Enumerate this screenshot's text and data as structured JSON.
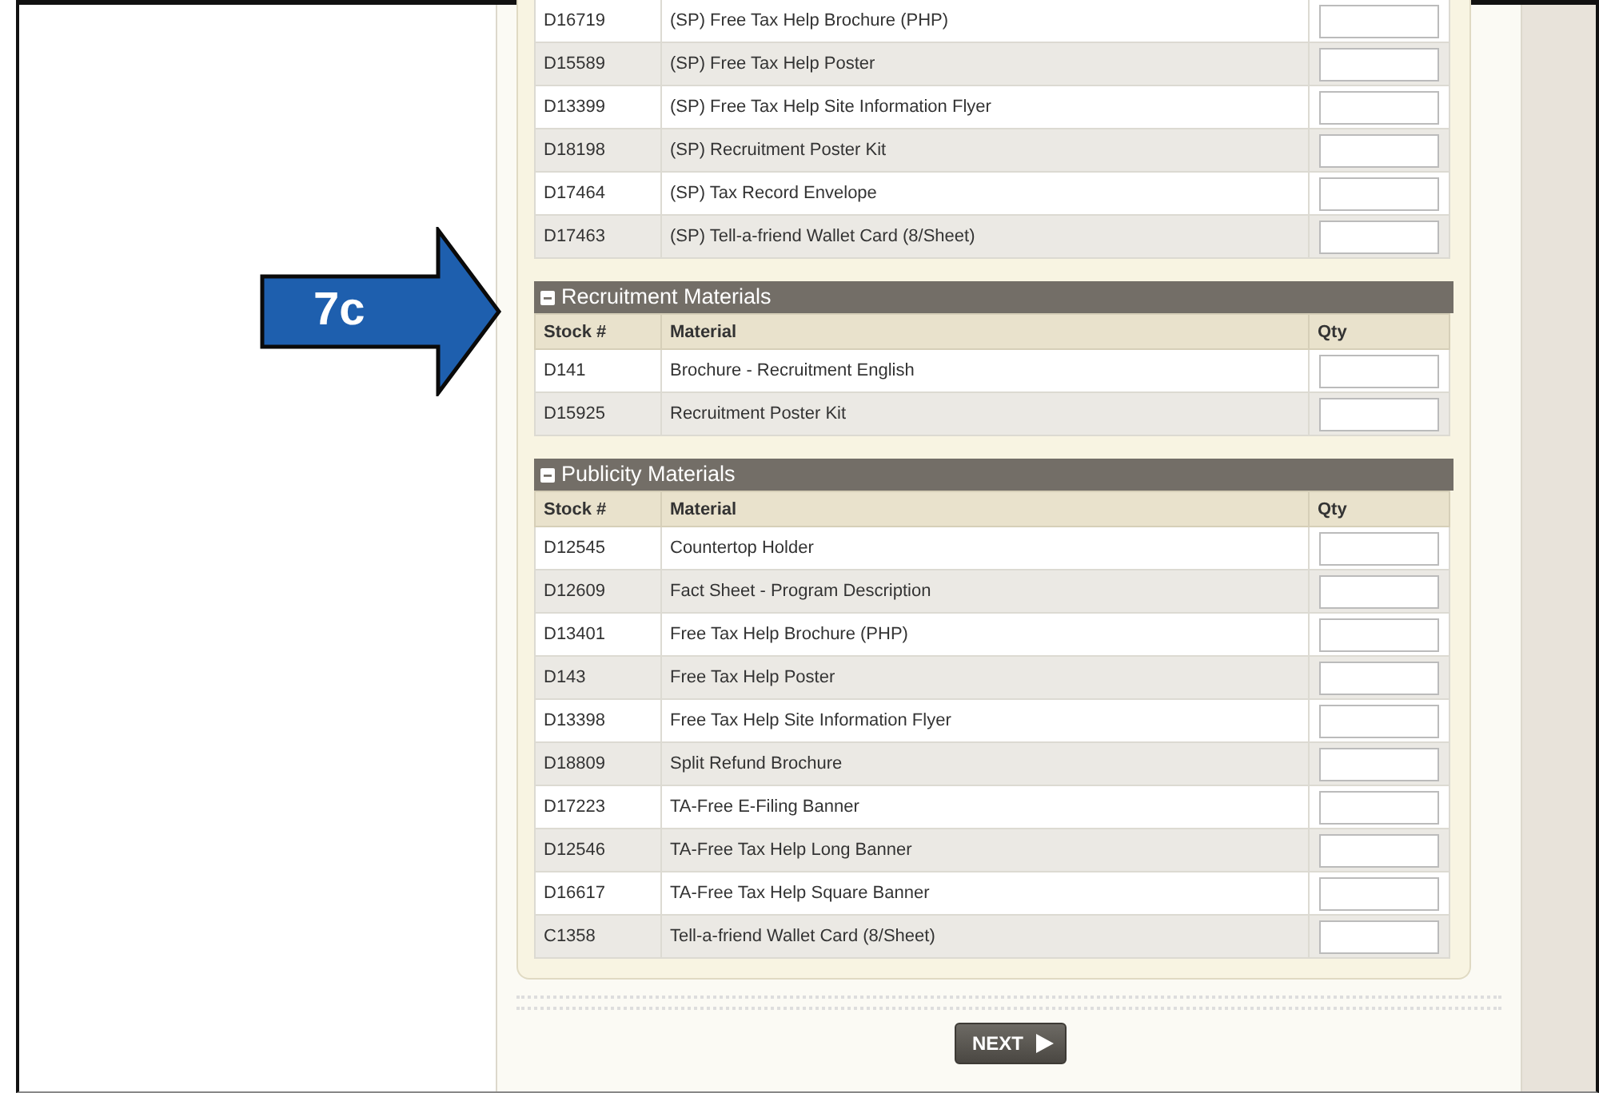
{
  "callout": {
    "label": "7c"
  },
  "sections": [
    {
      "rows": [
        {
          "stock": "D16719",
          "material": "(SP) Free Tax Help Brochure (PHP)"
        },
        {
          "stock": "D15589",
          "material": "(SP) Free Tax Help Poster"
        },
        {
          "stock": "D13399",
          "material": "(SP) Free Tax Help Site Information Flyer"
        },
        {
          "stock": "D18198",
          "material": "(SP) Recruitment Poster Kit"
        },
        {
          "stock": "D17464",
          "material": "(SP) Tax Record Envelope"
        },
        {
          "stock": "D17463",
          "material": "(SP) Tell-a-friend Wallet Card (8/Sheet)"
        }
      ]
    },
    {
      "title": "Recruitment Materials",
      "columns": [
        "Stock #",
        "Material",
        "Qty"
      ],
      "rows": [
        {
          "stock": "D141",
          "material": "Brochure - Recruitment English"
        },
        {
          "stock": "D15925",
          "material": "Recruitment Poster Kit"
        }
      ]
    },
    {
      "title": "Publicity Materials",
      "columns": [
        "Stock #",
        "Material",
        "Qty"
      ],
      "rows": [
        {
          "stock": "D12545",
          "material": "Countertop Holder"
        },
        {
          "stock": "D12609",
          "material": "Fact Sheet - Program Description"
        },
        {
          "stock": "D13401",
          "material": "Free Tax Help Brochure (PHP)"
        },
        {
          "stock": "D143",
          "material": "Free Tax Help Poster"
        },
        {
          "stock": "D13398",
          "material": "Free Tax Help Site Information Flyer"
        },
        {
          "stock": "D18809",
          "material": "Split Refund Brochure"
        },
        {
          "stock": "D17223",
          "material": "TA-Free E-Filing Banner"
        },
        {
          "stock": "D12546",
          "material": "TA-Free Tax Help Long Banner"
        },
        {
          "stock": "D16617",
          "material": "TA-Free Tax Help Square Banner"
        },
        {
          "stock": "C1358",
          "material": "Tell-a-friend Wallet Card (8/Sheet)"
        }
      ]
    }
  ],
  "next_button": {
    "label": "NEXT"
  }
}
